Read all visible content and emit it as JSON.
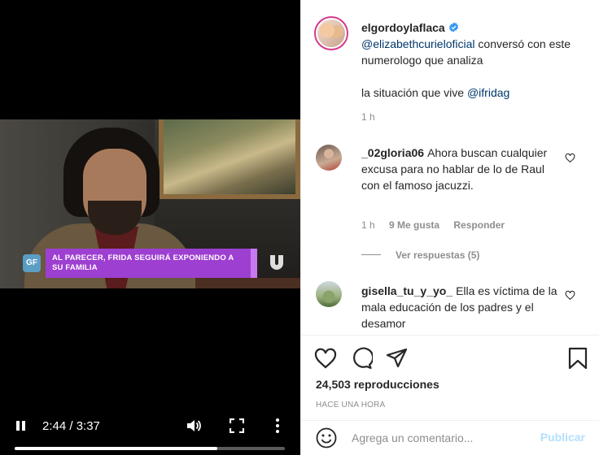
{
  "video": {
    "lower_third": "AL PARECER, FRIDA SEGUIRÁ EXPONIENDO A SU FAMILIA",
    "current_time": "2:44",
    "duration": "3:37",
    "time_display": "2:44 / 3:37",
    "progress_fraction": 0.749,
    "channel_logo": "GF"
  },
  "post": {
    "username": "elgordoylaflaca",
    "caption_mention": "@elizabethcurieloficial",
    "caption_text_1": " conversó con este numerologo que analiza",
    "caption_text_2": "la situación que vive ",
    "caption_mention_2": "@ifridag",
    "time": "1 h"
  },
  "comments": [
    {
      "username": "_02gloria06",
      "text": "Ahora buscan cualquier excusa para no hablar de lo de Raul con el famoso jacuzzi.",
      "time": "1 h",
      "likes": "9 Me gusta",
      "reply_label": "Responder",
      "view_replies": "Ver respuestas (5)"
    },
    {
      "username": "gisella_tu_y_yo_",
      "text": "Ella es víctima de la mala educación de los padres y el desamor"
    }
  ],
  "actions": {
    "views": "24,503 reproducciones",
    "posted": "HACE UNA HORA"
  },
  "add_comment": {
    "placeholder": "Agrega un comentario...",
    "publish_label": "Publicar"
  },
  "colors": {
    "lower_third": "#9d3fd1",
    "mention": "#00376b",
    "publish_disabled": "#b2dffc",
    "verified": "#3897f0"
  }
}
